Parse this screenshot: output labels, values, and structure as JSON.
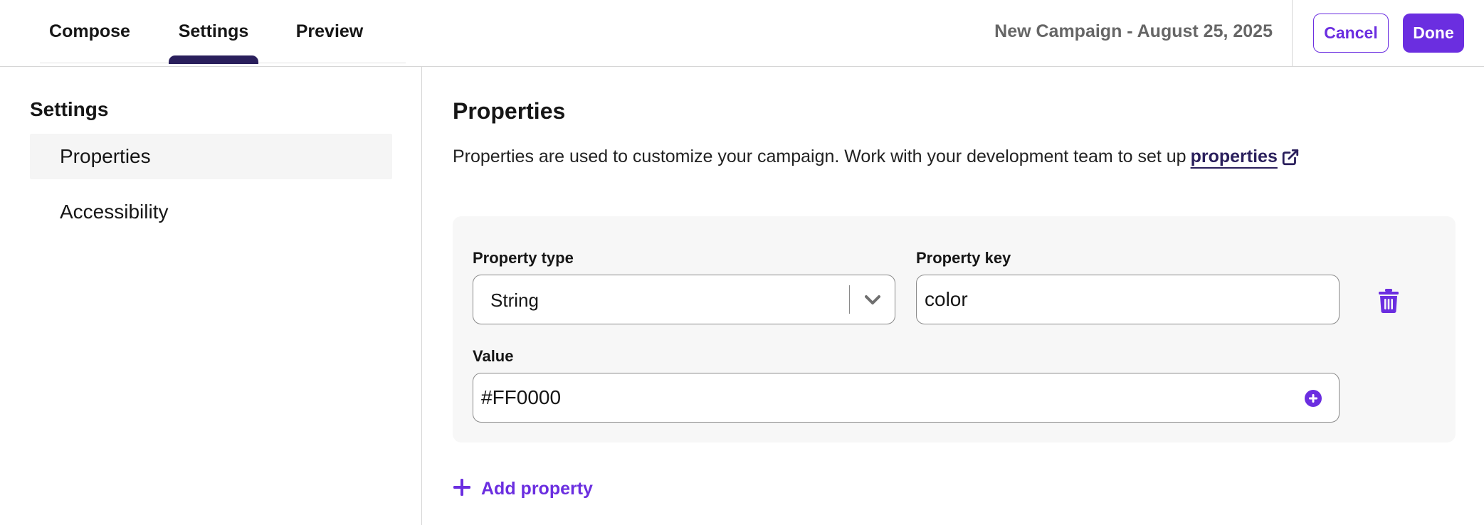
{
  "tabs": [
    {
      "label": "Compose"
    },
    {
      "label": "Settings",
      "active": true
    },
    {
      "label": "Preview"
    }
  ],
  "header": {
    "campaign_title": "New Campaign - August 25, 2025",
    "cancel_label": "Cancel",
    "done_label": "Done"
  },
  "sidebar": {
    "heading": "Settings",
    "items": [
      {
        "label": "Properties",
        "active": true
      },
      {
        "label": "Accessibility",
        "active": false
      }
    ]
  },
  "main": {
    "title": "Properties",
    "description": "Properties are used to customize your campaign. Work with your development team to set up",
    "link_label": "properties",
    "property": {
      "type_label": "Property type",
      "type_value": "String",
      "key_label": "Property key",
      "key_value": "color",
      "value_label": "Value",
      "value_value": "#FF0000"
    },
    "add_property_label": "Add property"
  },
  "colors": {
    "accent": "#6b2ee0",
    "tab_indicator": "#2a1f5c",
    "link": "#2a1f5c"
  },
  "icons": [
    "chevron-down-icon",
    "plus-circle-icon",
    "trash-icon",
    "external-link-icon",
    "plus-icon"
  ]
}
